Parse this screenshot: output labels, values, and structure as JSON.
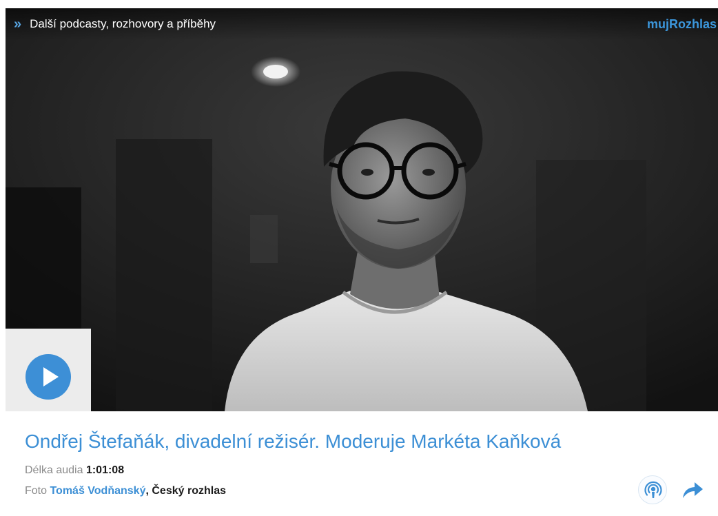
{
  "topbar": {
    "link_label": "Další podcasty, rozhovory a příběhy",
    "link_icon": "chevrons-right-icon",
    "brand": "mujRozhlas"
  },
  "player": {
    "play_icon": "play-icon",
    "photo_description": "black-and-white portrait photo"
  },
  "episode": {
    "title": "Ondřej Štefaňák, divadelní režisér. Moderuje Markéta Kaňková",
    "length_label": "Délka audia",
    "length_value": "1:01:08",
    "photo_label": "Foto",
    "photo_author": "Tomáš Vodňanský",
    "photo_separator": ",",
    "photo_source": "Český rozhlas"
  },
  "actions": {
    "podcast_icon": "podcast-icon",
    "share_icon": "share-arrow-icon"
  },
  "colors": {
    "accent": "#3c8fd5",
    "brand": "#3c97dc",
    "play_button": "#3d8fd6",
    "play_box": "#ececec"
  }
}
